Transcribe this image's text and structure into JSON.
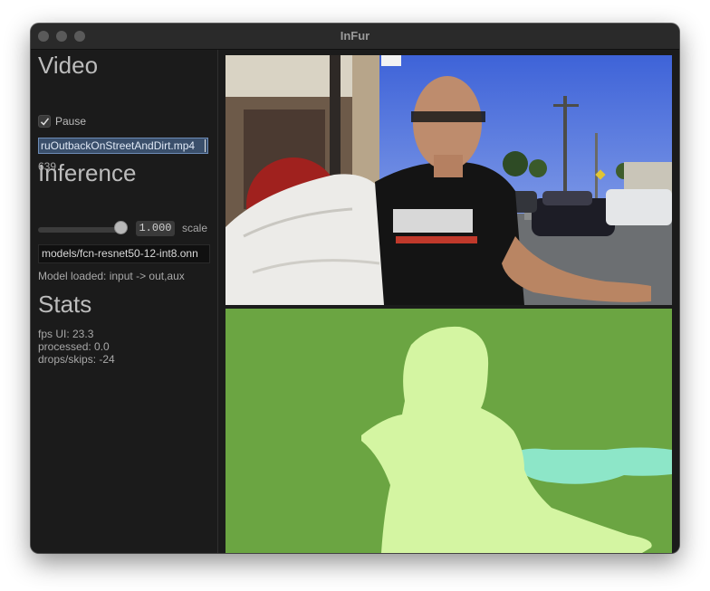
{
  "window": {
    "title": "InFur"
  },
  "video": {
    "heading": "Video",
    "pause_label": "Pause",
    "pause_checked": true,
    "file_value": "ruOutbackOnStreetAndDirt.mp4",
    "frame_number": "639"
  },
  "inference": {
    "heading": "Inference",
    "scale_value": "1.000",
    "scale_label": "scale",
    "model_path": "models/fcn-resnet50-12-int8.onn",
    "model_status": "Model loaded: input -> out,aux"
  },
  "stats": {
    "heading": "Stats",
    "fps_ui": "fps UI: 23.3",
    "processed": "processed: 0.0",
    "drops": "drops/skips: -24"
  },
  "segmentation": {
    "background_color": "#6ba542",
    "person_color": "#d4f5a2",
    "object_color": "#8de6c8"
  }
}
